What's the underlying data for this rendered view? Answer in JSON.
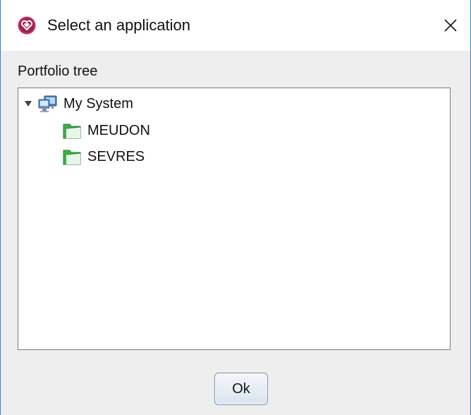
{
  "window": {
    "title": "Select an application",
    "app_icon": "heart-shield-icon",
    "close_icon": "close-icon"
  },
  "section_label": "Portfolio tree",
  "tree": {
    "root": {
      "label": "My System",
      "icon": "computer-network-icon",
      "expanded": true
    },
    "children": [
      {
        "label": "MEUDON",
        "icon": "green-folder-icon"
      },
      {
        "label": "SEVRES",
        "icon": "green-folder-icon"
      }
    ]
  },
  "buttons": {
    "ok_label": "Ok"
  },
  "colors": {
    "accent_border": "#2c84d8",
    "app_icon": "#c2305f",
    "folder_green": "#3dae49",
    "dialog_bg": "#eeeeee"
  }
}
